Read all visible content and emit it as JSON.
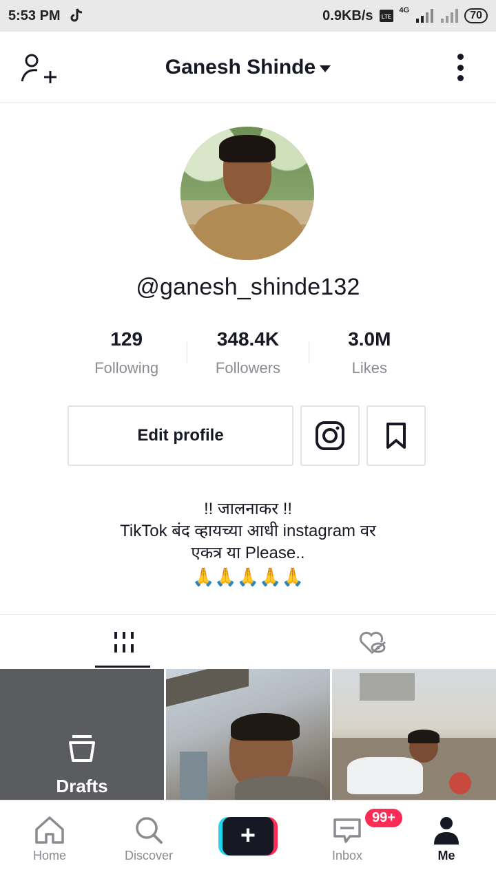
{
  "status_bar": {
    "time": "5:53 PM",
    "net_speed": "0.9KB/s",
    "network": "4G",
    "battery": "70"
  },
  "header": {
    "title": "Ganesh Shinde"
  },
  "profile": {
    "username": "@ganesh_shinde132",
    "stats": [
      {
        "value": "129",
        "label": "Following"
      },
      {
        "value": "348.4K",
        "label": "Followers"
      },
      {
        "value": "3.0M",
        "label": "Likes"
      }
    ],
    "edit_button": "Edit profile",
    "bio": {
      "line1": "!! जालनाकर !!",
      "line2": "TikTok बंद व्हायच्या आधी instagram वर",
      "line3": "एकत्र या Please..",
      "line4": "🙏🙏🙏🙏🙏"
    }
  },
  "grid": {
    "drafts_label": "Drafts"
  },
  "bottom_nav": {
    "items": [
      {
        "label": "Home",
        "icon": "home-icon"
      },
      {
        "label": "Discover",
        "icon": "search-icon"
      },
      {
        "label": "",
        "icon": "plus-icon"
      },
      {
        "label": "Inbox",
        "icon": "inbox-icon"
      },
      {
        "label": "Me",
        "icon": "person-icon"
      }
    ],
    "inbox_badge": "99+"
  },
  "colors": {
    "accent_pink": "#fe2c55",
    "accent_cyan": "#20d5ec",
    "text_primary": "#161823",
    "text_secondary": "#8a8b91"
  }
}
